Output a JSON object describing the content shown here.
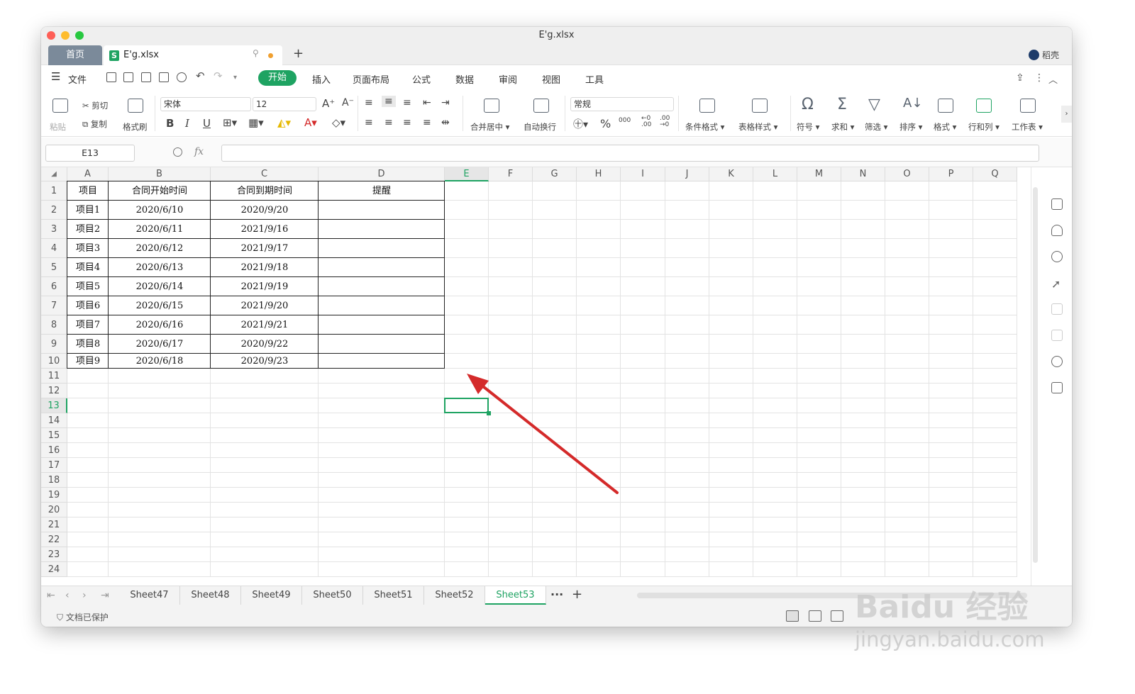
{
  "window": {
    "title": "E'g.xlsx"
  },
  "tabs": {
    "home": "首页",
    "document": "E'g.xlsx",
    "add": "+"
  },
  "user": {
    "name": "稻壳"
  },
  "menu": {
    "file": "文件",
    "items": [
      "开始",
      "插入",
      "页面布局",
      "公式",
      "数据",
      "审阅",
      "视图",
      "工具"
    ]
  },
  "ribbon": {
    "paste": "粘贴",
    "cut": "剪切",
    "copy": "复制",
    "format_painter": "格式刷",
    "font_name": "宋体",
    "font_size": "12",
    "bold": "B",
    "italic": "I",
    "underline": "U",
    "merge_center": "合并居中",
    "wrap_text": "自动换行",
    "number_format": "常规",
    "percent": "%",
    "thousands": "000",
    "cond_format": "条件格式",
    "table_style": "表格样式",
    "symbol": "符号",
    "sum": "求和",
    "filter": "筛选",
    "sort": "排序",
    "format": "格式",
    "row_col": "行和列",
    "worksheet": "工作表"
  },
  "formula_bar": {
    "name_box": "E13",
    "fx": "fx",
    "value": ""
  },
  "columns": [
    "A",
    "B",
    "C",
    "D",
    "E",
    "F",
    "G",
    "H",
    "I",
    "J",
    "K",
    "L",
    "M",
    "N",
    "O",
    "P",
    "Q"
  ],
  "rows": [
    "1",
    "2",
    "3",
    "4",
    "5",
    "6",
    "7",
    "8",
    "9",
    "10",
    "11",
    "12",
    "13",
    "14",
    "15",
    "16",
    "17",
    "18",
    "19",
    "20",
    "21",
    "22",
    "23",
    "24"
  ],
  "table": {
    "headers": [
      "项目",
      "合同开始时间",
      "合同到期时间",
      "提醒"
    ],
    "rows": [
      [
        "项目1",
        "2020/6/10",
        "2020/9/20",
        ""
      ],
      [
        "项目2",
        "2020/6/11",
        "2021/9/16",
        ""
      ],
      [
        "项目3",
        "2020/6/12",
        "2021/9/17",
        ""
      ],
      [
        "项目4",
        "2020/6/13",
        "2021/9/18",
        ""
      ],
      [
        "项目5",
        "2020/6/14",
        "2021/9/19",
        ""
      ],
      [
        "项目6",
        "2020/6/15",
        "2021/9/20",
        ""
      ],
      [
        "项目7",
        "2020/6/16",
        "2021/9/21",
        ""
      ],
      [
        "项目8",
        "2020/6/17",
        "2020/9/22",
        ""
      ],
      [
        "项目9",
        "2020/6/18",
        "2020/9/23",
        ""
      ]
    ]
  },
  "sheets": [
    "Sheet47",
    "Sheet48",
    "Sheet49",
    "Sheet50",
    "Sheet51",
    "Sheet52",
    "Sheet53"
  ],
  "active_sheet": "Sheet53",
  "more_sheets": "···",
  "status": {
    "protected": "文档已保护"
  },
  "watermark": {
    "brand": "Baidu 经验",
    "url": "jingyan.baidu.com"
  },
  "colors": {
    "accent": "#1ea362",
    "arrow": "#d42a2a"
  }
}
